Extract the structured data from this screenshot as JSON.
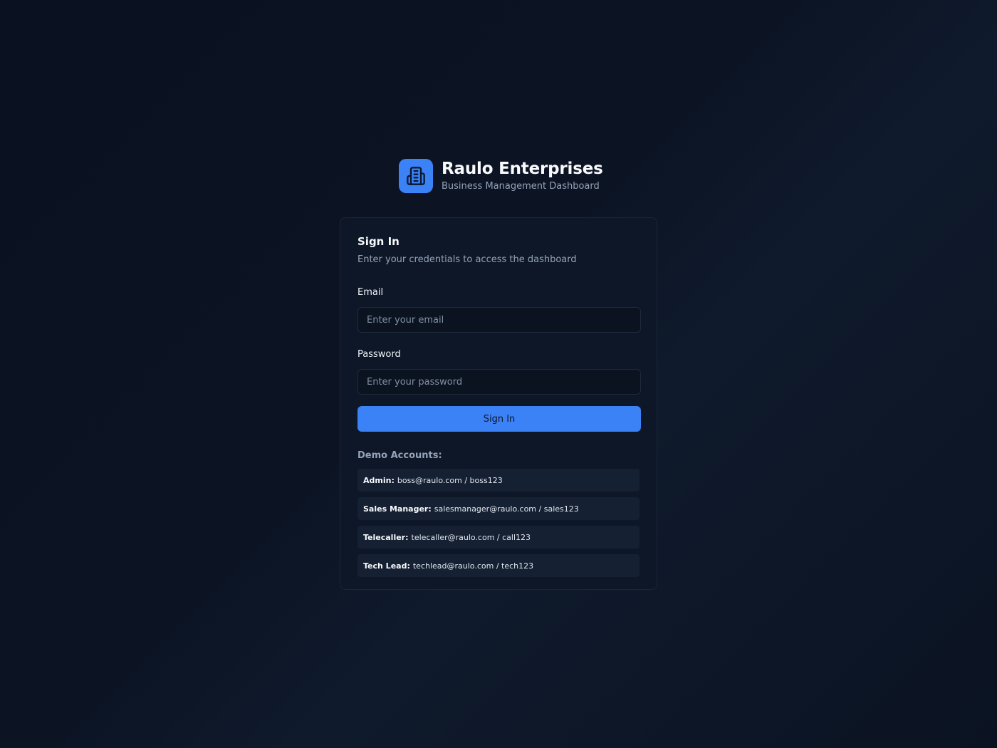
{
  "brand": {
    "icon": "building-icon",
    "title": "Raulo Enterprises",
    "subtitle": "Business Management Dashboard"
  },
  "signin": {
    "title": "Sign In",
    "description": "Enter your credentials to access the dashboard",
    "email_label": "Email",
    "email_value": "",
    "email_placeholder": "Enter your email",
    "password_label": "Password",
    "password_value": "",
    "password_placeholder": "Enter your password",
    "button_label": "Sign In"
  },
  "demo": {
    "title": "Demo Accounts:",
    "accounts": [
      {
        "role": "Admin:",
        "credentials": "boss@raulo.com / boss123"
      },
      {
        "role": "Sales Manager:",
        "credentials": "salesmanager@raulo.com / sales123"
      },
      {
        "role": "Telecaller:",
        "credentials": "telecaller@raulo.com / call123"
      },
      {
        "role": "Tech Lead:",
        "credentials": "techlead@raulo.com / tech123"
      }
    ]
  },
  "colors": {
    "accent": "#3b82f6",
    "background": "#0b1322",
    "card": "#0e1727"
  }
}
